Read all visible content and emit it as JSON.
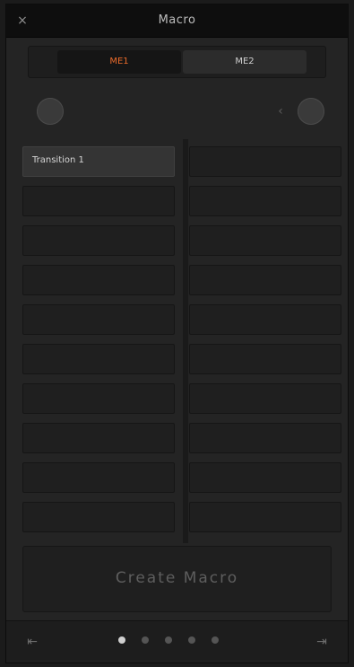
{
  "window": {
    "title": "Macro",
    "close_glyph": "×"
  },
  "tabs": [
    {
      "label": "ME1",
      "active": true
    },
    {
      "label": "ME2",
      "active": false
    }
  ],
  "tools": {
    "left_button_icon": "record-icon",
    "right_glyph": "‹",
    "right_button_icon": "settings-icon"
  },
  "macros": {
    "left_column": [
      {
        "label": "Transition 1",
        "active": true
      },
      {
        "label": "",
        "active": false
      },
      {
        "label": "",
        "active": false
      },
      {
        "label": "",
        "active": false
      },
      {
        "label": "",
        "active": false
      },
      {
        "label": "",
        "active": false
      },
      {
        "label": "",
        "active": false
      },
      {
        "label": "",
        "active": false
      },
      {
        "label": "",
        "active": false
      },
      {
        "label": "",
        "active": false
      }
    ],
    "right_column": [
      {
        "label": "",
        "active": false
      },
      {
        "label": "",
        "active": false
      },
      {
        "label": "",
        "active": false
      },
      {
        "label": "",
        "active": false
      },
      {
        "label": "",
        "active": false
      },
      {
        "label": "",
        "active": false
      },
      {
        "label": "",
        "active": false
      },
      {
        "label": "",
        "active": false
      },
      {
        "label": "",
        "active": false
      },
      {
        "label": "",
        "active": false
      }
    ]
  },
  "bottom_button": {
    "label": "Create Macro"
  },
  "footer": {
    "left_glyph": "⇤",
    "right_glyph": "⇥",
    "pages": 5,
    "current_page": 1
  },
  "colors": {
    "accent": "#e86a2a",
    "background": "#242424",
    "titlebar": "#0e0e0e"
  }
}
